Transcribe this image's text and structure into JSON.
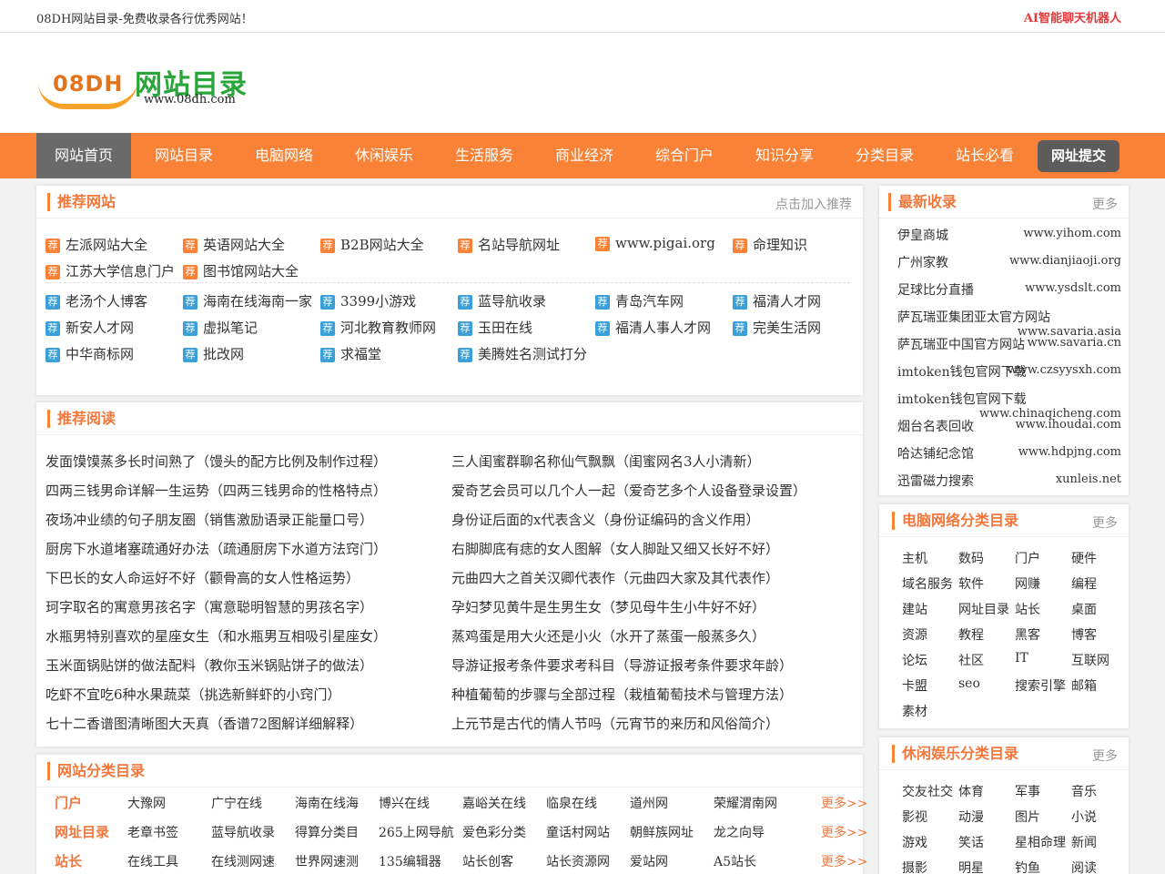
{
  "topbar": {
    "tagline": "08DH网站目录-免费收录各行优秀网站！",
    "ai_link": "AI智能聊天机器人"
  },
  "logo": {
    "mark": "08DH",
    "name": "网站目录",
    "url": "www.08dh.com"
  },
  "nav": {
    "items": [
      "网站首页",
      "网站目录",
      "电脑网络",
      "休闲娱乐",
      "生活服务",
      "商业经济",
      "综合门户",
      "知识分享",
      "分类目录",
      "站长必看"
    ],
    "submit": "网址提交"
  },
  "recommend": {
    "title": "推荐网站",
    "more": "点击加入推荐",
    "tag": "荐",
    "featured": [
      "左派网站大全",
      "英语网站大全",
      "B2B网站大全",
      "名站导航网址",
      "www.pigai.org",
      "命理知识",
      "江苏大学信息门户",
      "图书馆网站大全"
    ],
    "normal": [
      "老汤个人博客",
      "海南在线海南一家",
      "3399小游戏",
      "蓝导航收录",
      "青岛汽车网",
      "福清人才网",
      "新安人才网",
      "虚拟笔记",
      "河北教育教师网",
      "玉田在线",
      "福清人事人才网",
      "完美生活网",
      "中华商标网",
      "批改网",
      "求福堂",
      "美腾姓名测试打分"
    ]
  },
  "reading": {
    "title": "推荐阅读",
    "items": [
      "发面馍馍蒸多长时间熟了（馒头的配方比例及制作过程）",
      "三人闺蜜群聊名称仙气飘飘（闺蜜网名3人小清新）",
      "四两三钱男命详解一生运势（四两三钱男命的性格特点）",
      "爱奇艺会员可以几个人一起（爱奇艺多个人设备登录设置）",
      "夜场冲业绩的句子朋友圈（销售激励语录正能量口号）",
      "身份证后面的x代表含义（身份证编码的含义作用）",
      "厨房下水道堵塞疏通好办法（疏通厨房下水道方法窍门）",
      "右脚脚底有痣的女人图解（女人脚趾又细又长好不好）",
      "下巴长的女人命运好不好（颧骨高的女人性格运势）",
      "元曲四大之首关汉卿代表作（元曲四大家及其代表作）",
      "珂字取名的寓意男孩名字（寓意聪明智慧的男孩名字）",
      "孕妇梦见黄牛是生男生女（梦见母牛生小牛好不好）",
      "水瓶男特别喜欢的星座女生（和水瓶男互相吸引星座女）",
      "蒸鸡蛋是用大火还是小火（水开了蒸蛋一般蒸多久）",
      "玉米面锅贴饼的做法配料（教你玉米锅贴饼子的做法）",
      "导游证报考条件要求考科目（导游证报考条件要求年龄）",
      "吃虾不宜吃6种水果蔬菜（挑选新鲜虾的小窍门）",
      "种植葡萄的步骤与全部过程（栽植葡萄技术与管理方法）",
      "七十二香谱图清晰图大天真（香谱72图解详细解释）",
      "上元节是古代的情人节吗（元宵节的来历和风俗简介）"
    ]
  },
  "categories": {
    "title": "网站分类目录",
    "rows": [
      {
        "label": "门户",
        "links": [
          "大豫网",
          "广宁在线",
          "海南在线海",
          "博兴在线",
          "嘉峪关在线",
          "临泉在线",
          "道州网",
          "荣耀渭南网"
        ],
        "more": "更多>>"
      },
      {
        "label": "网址目录",
        "links": [
          "老章书签",
          "蓝导航收录",
          "得算分类目",
          "265上网导航",
          "爱色彩分类",
          "童话村网站",
          "朝鲜族网址",
          "龙之向导"
        ],
        "more": "更多>>"
      },
      {
        "label": "站长",
        "links": [
          "在线工具",
          "在线测网速",
          "世界网速测",
          "135编辑器",
          "站长创客",
          "站长资源网",
          "爱站网",
          "A5站长"
        ],
        "more": "更多>>"
      }
    ]
  },
  "latest": {
    "title": "最新收录",
    "more": "更多",
    "items": [
      {
        "name": "伊皇商城",
        "url": "www.yihom.com"
      },
      {
        "name": "广州家教",
        "url": "www.dianjiaoji.org"
      },
      {
        "name": "足球比分直播",
        "url": "www.ysdslt.com"
      },
      {
        "name": "萨瓦瑞亚集团亚太官方网站",
        "url": "www.savaria.asia"
      },
      {
        "name": "萨瓦瑞亚中国官方网站",
        "url": "www.savaria.cn"
      },
      {
        "name": "imtoken钱包官网下载",
        "url": "www.czsyysxh.com"
      },
      {
        "name": "imtoken钱包官网下载",
        "url": "www.chinaqicheng.com"
      },
      {
        "name": "烟台名表回收",
        "url": "www.ihoudai.com"
      },
      {
        "name": "哈达铺纪念馆",
        "url": "www.hdpjng.com"
      },
      {
        "name": "迅雷磁力搜索",
        "url": "xunleis.net"
      }
    ]
  },
  "computer_cats": {
    "title": "电脑网络分类目录",
    "more": "更多",
    "items": [
      "主机",
      "数码",
      "门户",
      "硬件",
      "域名服务",
      "软件",
      "网赚",
      "编程",
      "建站",
      "网址目录",
      "站长",
      "桌面",
      "资源",
      "教程",
      "黑客",
      "博客",
      "论坛",
      "社区",
      "IT",
      "互联网",
      "卡盟",
      "seo",
      "搜索引擎",
      "邮箱",
      "素材"
    ]
  },
  "leisure_cats": {
    "title": "休闲娱乐分类目录",
    "more": "更多",
    "items": [
      "交友社交",
      "体育",
      "军事",
      "音乐",
      "影视",
      "动漫",
      "图片",
      "小说",
      "游戏",
      "笑话",
      "星相命理",
      "新闻",
      "摄影",
      "明星",
      "钓鱼",
      "阅读"
    ]
  }
}
